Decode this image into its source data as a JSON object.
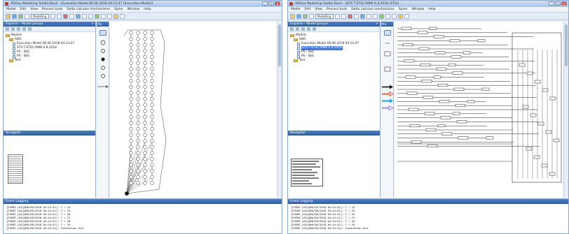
{
  "panels": [
    {
      "title": "ADOxx Modelling Toolkit Dach - [Execution Model 06.06.2018 04:13:47 (Execution Model)]",
      "menu": [
        "Model",
        "Edit",
        "View",
        "Process tools",
        "Delta calculus mechanisms",
        "Spine",
        "Window",
        "Help"
      ],
      "mode": "Modelling",
      "explorer_title": "Explorer - Model groups",
      "tree": [
        {
          "label": "Models",
          "kind": "folder",
          "level": 0,
          "selected": false
        },
        {
          "label": "SW1",
          "kind": "folder",
          "level": 1,
          "selected": false
        },
        {
          "label": "Execution Model 06.06.2018 04:13:47",
          "kind": "doc",
          "level": 2,
          "selected": false
        },
        {
          "label": "STS T-STS2 AMW 6.8.2018",
          "kind": "doc",
          "level": 2,
          "selected": false
        },
        {
          "label": "PS - SEG",
          "kind": "doc",
          "level": 2,
          "selected": false
        },
        {
          "label": "PS - SEG",
          "kind": "doc",
          "level": 2,
          "selected": false
        },
        {
          "label": "Test",
          "kind": "folder",
          "level": 1,
          "selected": false
        }
      ],
      "navigator_title": "Navigator",
      "logging_title": "Event Logging",
      "log": [
        "[EVENT_LOG]@06/06/2018 04:44:41]: T = 24",
        "[EVENT_LOG]@06/06/2018 04:44:41]: T = 25",
        "[EVENT_LOG]@06/06/2018 04:44:41]: T = 26",
        "[EVENT_LOG]@06/06/2018 04:44:41]: T = 27",
        "[EVENT_LOG]@06/06/2018 04:44:41]: T = 28",
        "[EVENT_LOG]@06/06/2018 04:44:41]: T = 29",
        "[EVENT_LOG]@06/06/2018 04:44:44]: Simulation End."
      ]
    },
    {
      "title": "ADOxx Modelling Toolkit Dach - [STS T-STS2 AMW 6.8.2018 (STS)]",
      "menu": [
        "Model",
        "Edit",
        "View",
        "Process tools",
        "Delta calculus mechanisms",
        "Spine",
        "Window",
        "Help"
      ],
      "mode": "Modelling",
      "explorer_title": "Explorer - Model groups",
      "tree": [
        {
          "label": "Models",
          "kind": "folder",
          "level": 0,
          "selected": false
        },
        {
          "label": "SW1",
          "kind": "folder",
          "level": 1,
          "selected": false
        },
        {
          "label": "Execution Model 06.06.2018 04:13:47",
          "kind": "doc",
          "level": 2,
          "selected": false
        },
        {
          "label": "STS T-STS2 AMW 6.8.2018",
          "kind": "doc",
          "level": 2,
          "selected": true
        },
        {
          "label": "PS - SEG",
          "kind": "doc",
          "level": 2,
          "selected": false
        },
        {
          "label": "PS - SEG",
          "kind": "doc",
          "level": 2,
          "selected": false
        },
        {
          "label": "Test",
          "kind": "folder",
          "level": 1,
          "selected": false
        }
      ],
      "navigator_title": "Navigator",
      "logging_title": "Event Logging",
      "log": [
        "[EVENT_LOG]@06/06/2018 04:44:41]: T = 24",
        "[EVENT_LOG]@06/06/2018 04:44:41]: T = 25",
        "[EVENT_LOG]@06/06/2018 04:44:41]: T = 26",
        "[EVENT_LOG]@06/06/2018 04:44:41]: T = 27",
        "[EVENT_LOG]@06/06/2018 04:44:41]: T = 28",
        "[EVENT_LOG]@06/06/2018 04:44:41]: T = 29",
        "[EVENT_LOG]@06/06/2018 04:44:44]: Simulation End."
      ]
    }
  ],
  "icons": {
    "app": "app-logo-icon",
    "close": "close-icon",
    "arrow_black": "arrow-right-icon",
    "arrow_red": "arrow-right-icon",
    "arrow_blue": "arrow-right-icon",
    "arrow_violet": "arrow-right-icon"
  },
  "colors": {
    "panel_title": "#2f5da3",
    "selection": "#3d7be0",
    "arrow_black": "#111111",
    "arrow_red": "#e04a2a",
    "arrow_blue": "#23a0e0",
    "arrow_violet": "#8a7be0"
  }
}
